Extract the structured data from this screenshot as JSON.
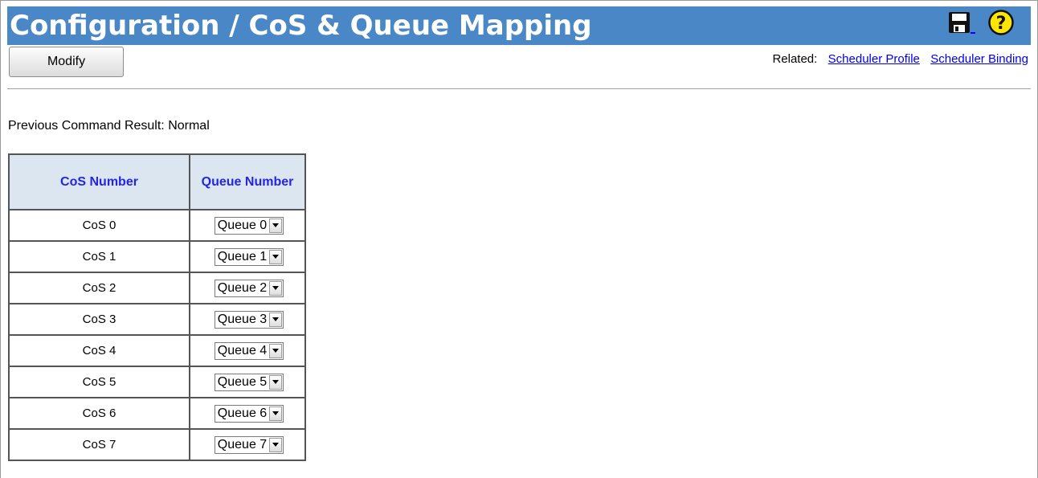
{
  "header": {
    "title": "Configuration / CoS & Queue Mapping",
    "bg_color": "#4a87c6",
    "icons": [
      "save-icon",
      "help-icon"
    ]
  },
  "toolbar": {
    "modify_label": "Modify"
  },
  "related": {
    "label": "Related:",
    "links": [
      "Scheduler Profile",
      "Scheduler Binding"
    ]
  },
  "status": {
    "previous_result": "Previous Command Result: Normal"
  },
  "table": {
    "headers": [
      "CoS Number",
      "Queue Number"
    ],
    "header_bg": "#dce6f1",
    "header_color": "#2424e8",
    "rows": [
      {
        "cos": "CoS 0",
        "queue": "Queue 0"
      },
      {
        "cos": "CoS 1",
        "queue": "Queue 1"
      },
      {
        "cos": "CoS 2",
        "queue": "Queue 2"
      },
      {
        "cos": "CoS 3",
        "queue": "Queue 3"
      },
      {
        "cos": "CoS 4",
        "queue": "Queue 4"
      },
      {
        "cos": "CoS 5",
        "queue": "Queue 5"
      },
      {
        "cos": "CoS 6",
        "queue": "Queue 6"
      },
      {
        "cos": "CoS 7",
        "queue": "Queue 7"
      }
    ]
  }
}
